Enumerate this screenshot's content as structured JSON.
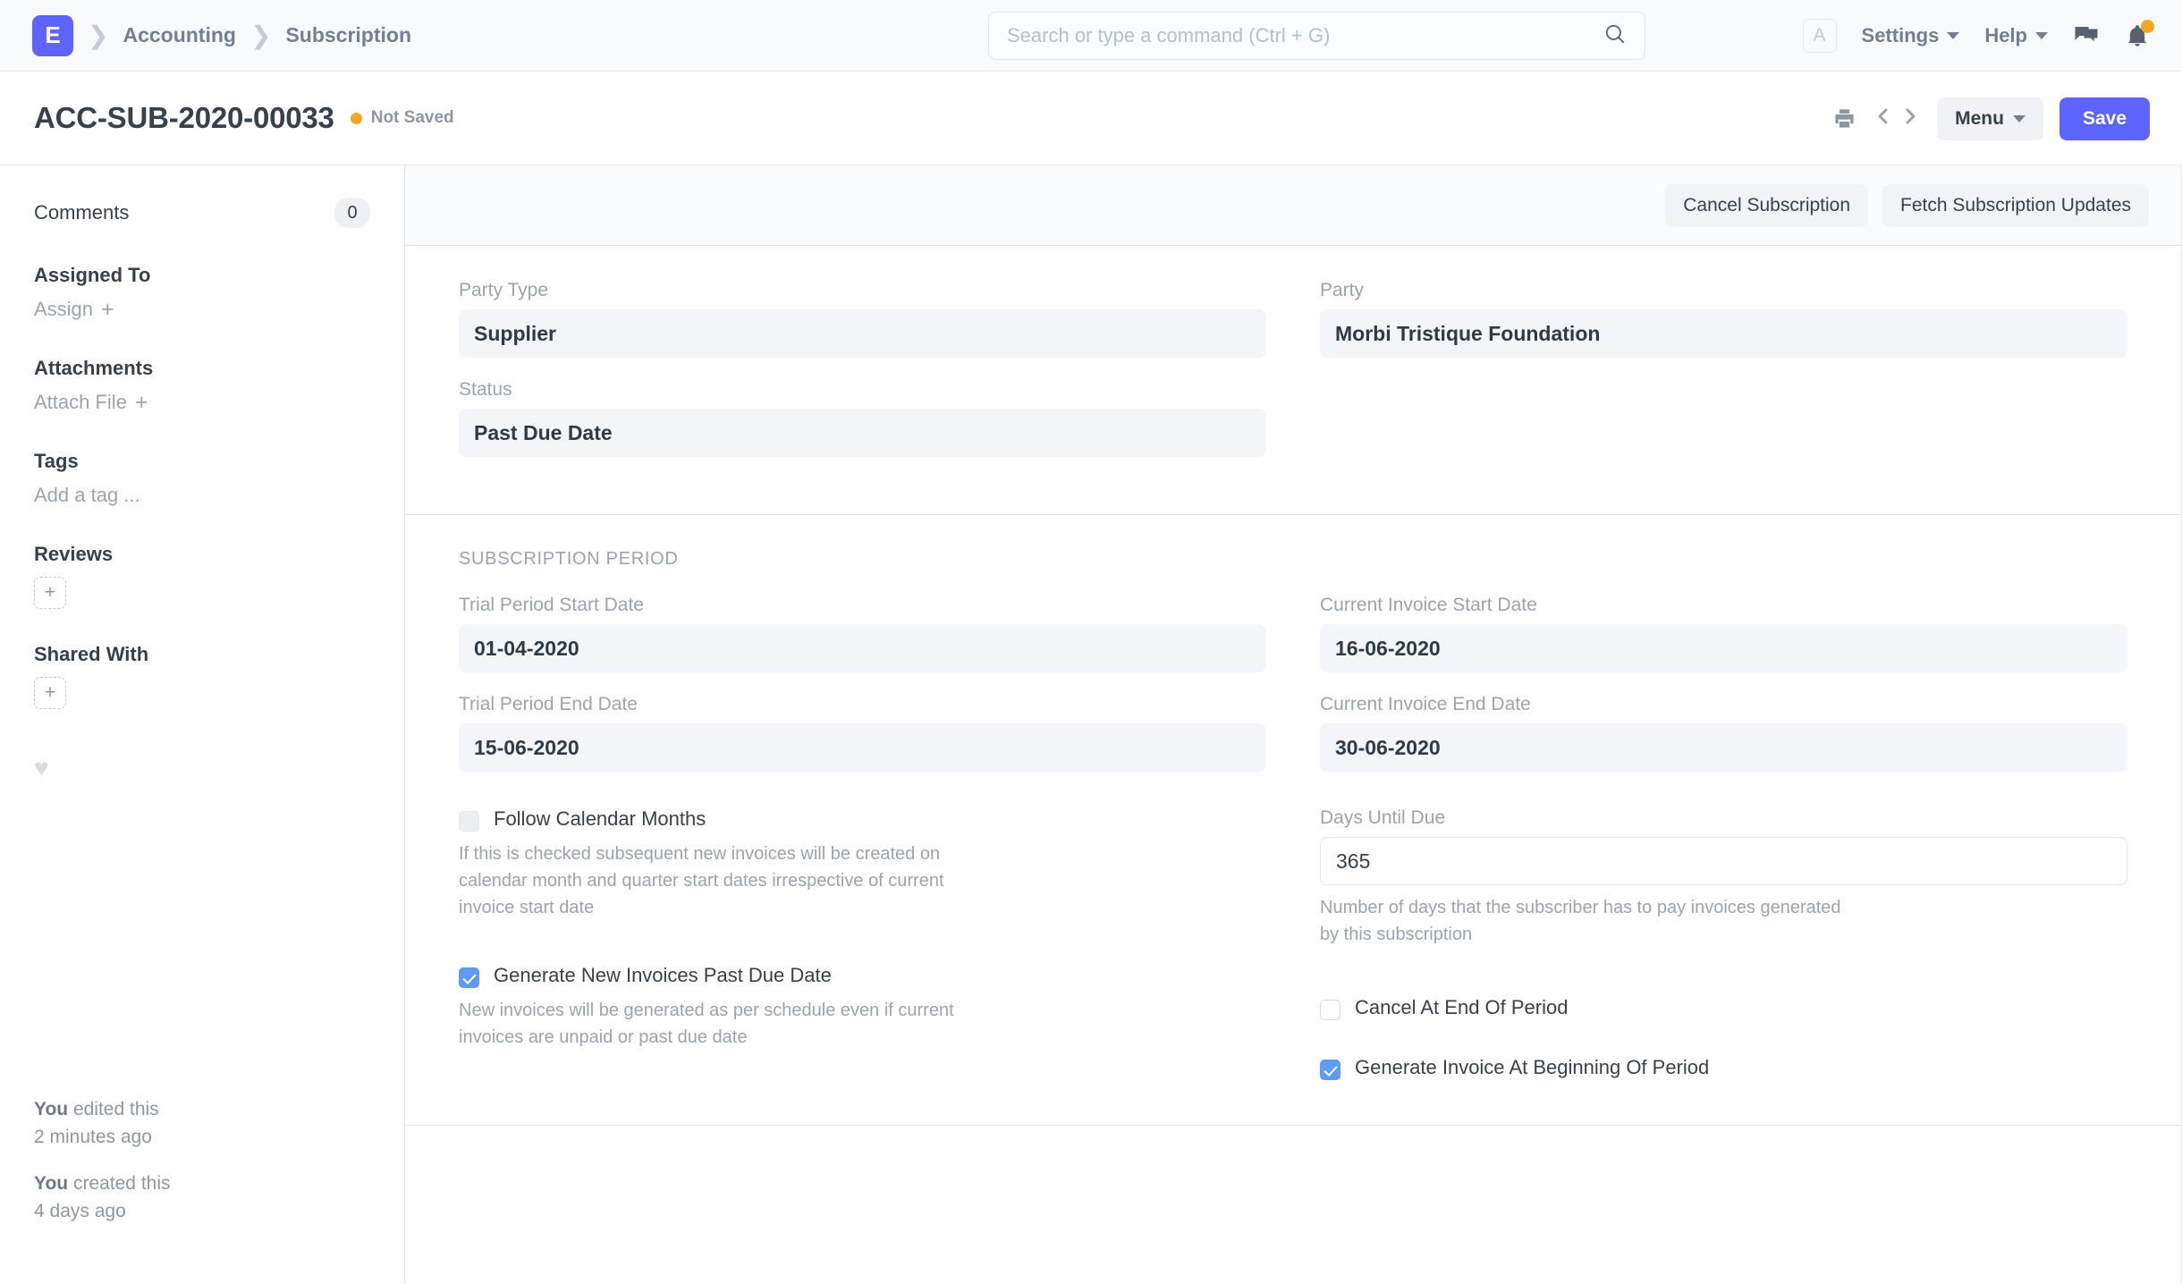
{
  "navbar": {
    "logo_letter": "E",
    "breadcrumbs": [
      "Accounting",
      "Subscription"
    ],
    "search": {
      "placeholder": "Search or type a command (Ctrl + G)",
      "value": ""
    },
    "avatar_letter": "A",
    "settings_label": "Settings",
    "help_label": "Help"
  },
  "pagehead": {
    "title": "ACC-SUB-2020-00033",
    "status_label": "Not Saved",
    "status_color": "#f5a623",
    "menu_label": "Menu",
    "save_label": "Save",
    "save_color": "#5e64ff"
  },
  "sidebar": {
    "comments_label": "Comments",
    "comments_count": "0",
    "assigned_to_label": "Assigned To",
    "assign_action": "Assign",
    "attachments_label": "Attachments",
    "attach_action": "Attach File",
    "tags_label": "Tags",
    "add_tag_action": "Add a tag ...",
    "reviews_label": "Reviews",
    "shared_with_label": "Shared With",
    "timeline": [
      {
        "actor": "You",
        "action": " edited this",
        "time": "2 minutes ago"
      },
      {
        "actor": "You",
        "action": " created this",
        "time": "4 days ago"
      }
    ]
  },
  "main": {
    "actions": [
      {
        "label": "Cancel Subscription"
      },
      {
        "label": "Fetch Subscription Updates"
      }
    ],
    "party_type": {
      "label": "Party Type",
      "value": "Supplier"
    },
    "party": {
      "label": "Party",
      "value": "Morbi Tristique Foundation"
    },
    "status": {
      "label": "Status",
      "value": "Past Due Date"
    },
    "subscription_period": {
      "section_title": "Subscription Period",
      "trial_start": {
        "label": "Trial Period Start Date",
        "value": "01-04-2020"
      },
      "trial_end": {
        "label": "Trial Period End Date",
        "value": "15-06-2020"
      },
      "invoice_start": {
        "label": "Current Invoice Start Date",
        "value": "16-06-2020"
      },
      "invoice_end": {
        "label": "Current Invoice End Date",
        "value": "30-06-2020"
      },
      "follow_calendar": {
        "label": "Follow Calendar Months",
        "checked": false,
        "help": "If this is checked subsequent new invoices will be created on calendar month and quarter start dates irrespective of current invoice start date"
      },
      "generate_past_due": {
        "label": "Generate New Invoices Past Due Date",
        "checked": true,
        "help": "New invoices will be generated as per schedule even if current invoices are unpaid or past due date"
      },
      "days_until_due": {
        "label": "Days Until Due",
        "value": "365",
        "help": "Number of days that the subscriber has to pay invoices generated by this subscription"
      },
      "cancel_at_end": {
        "label": "Cancel At End Of Period",
        "checked": false
      },
      "generate_at_beginning": {
        "label": "Generate Invoice At Beginning Of Period",
        "checked": true
      }
    }
  }
}
